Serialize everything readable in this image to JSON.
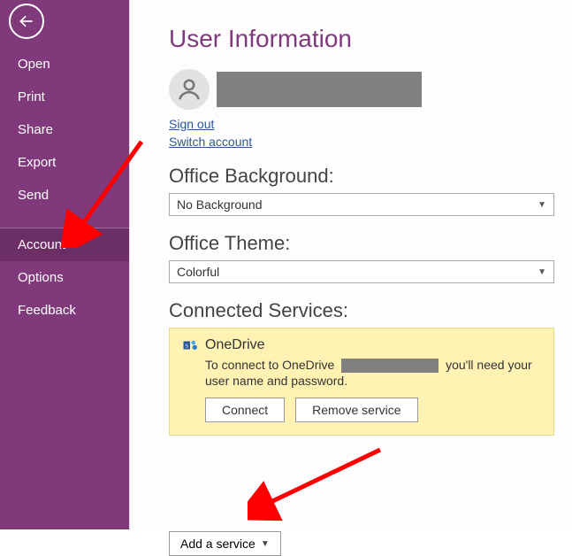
{
  "sidebar": {
    "items": [
      {
        "label": "Open"
      },
      {
        "label": "Print"
      },
      {
        "label": "Share"
      },
      {
        "label": "Export"
      },
      {
        "label": "Send"
      },
      {
        "label": "Account"
      },
      {
        "label": "Options"
      },
      {
        "label": "Feedback"
      }
    ]
  },
  "page": {
    "title": "User Information",
    "sign_out": "Sign out",
    "switch_account": "Switch account"
  },
  "background": {
    "heading": "Office Background:",
    "value": "No Background"
  },
  "theme": {
    "heading": "Office Theme:",
    "value": "Colorful"
  },
  "connected": {
    "heading": "Connected Services:",
    "service_name": "OneDrive",
    "desc_prefix": "To connect to OneDrive",
    "desc_suffix": "you'll need your user name and password.",
    "connect_label": "Connect",
    "remove_label": "Remove service"
  },
  "add_service": {
    "label": "Add a service"
  }
}
